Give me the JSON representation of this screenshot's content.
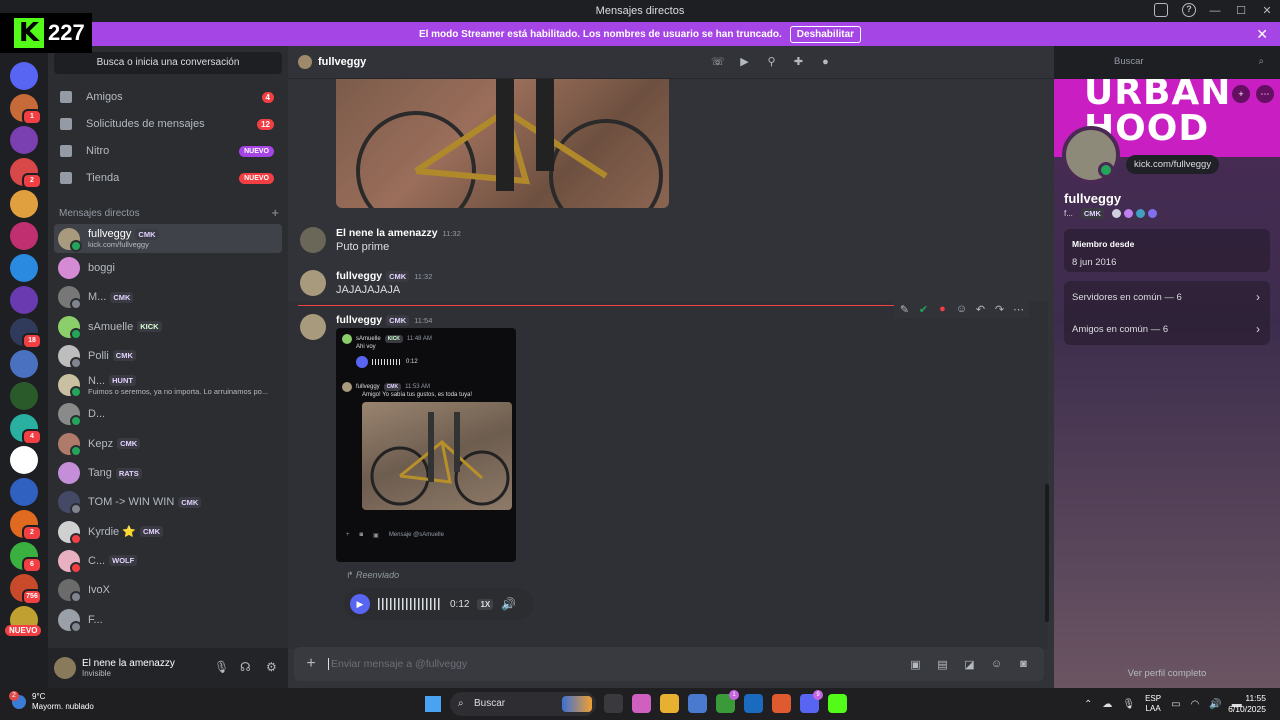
{
  "titlebar": {
    "title": "Mensajes directos"
  },
  "overlay": {
    "kick_count": "227"
  },
  "streamer_bar": {
    "text": "El modo Streamer está habilitado. Los nombres de usuario se han truncado.",
    "button": "Deshabilitar"
  },
  "guilds": {
    "badges": [
      "1",
      "2",
      "18",
      "4",
      "2",
      "6",
      "756"
    ],
    "new_label": "NUEVO"
  },
  "sidebar": {
    "search_placeholder": "Busca o inicia una conversación",
    "nav": [
      {
        "label": "Amigos",
        "count": "4"
      },
      {
        "label": "Solicitudes de mensajes",
        "count": "12"
      },
      {
        "label": "Nitro",
        "pill": "NUEVO"
      },
      {
        "label": "Tienda",
        "pill": "NUEVO"
      }
    ],
    "dm_header": "Mensajes directos",
    "dm_add": "+",
    "dms": [
      {
        "name": "fullveggy",
        "tag": "CMK",
        "sub": "kick.com/fullveggy",
        "color": "#a89a7d",
        "status": "#23a55a"
      },
      {
        "name": "boggi",
        "tag": "",
        "sub": "",
        "color": "#d58ad4",
        "status": ""
      },
      {
        "name": "M...",
        "tag": "CMK",
        "sub": "",
        "color": "#777777",
        "status": "#80848e"
      },
      {
        "name": "sAmuelle",
        "tag": "KICK",
        "sub": "",
        "color": "#8bcf6b",
        "status": "#23a55a"
      },
      {
        "name": "Polli",
        "tag": "CMK",
        "sub": "",
        "color": "#bdbdbd",
        "status": "#80848e"
      },
      {
        "name": "N...",
        "tag": "HUNT",
        "sub": "Fuimos o seremos, ya no importa. Lo arruinamos po...",
        "color": "#c8c0a0",
        "status": "#23a55a"
      },
      {
        "name": "D...",
        "tag": "",
        "sub": "",
        "color": "#8a8a8a",
        "status": "#23a55a"
      },
      {
        "name": "Kepz",
        "tag": "CMK",
        "sub": "",
        "color": "#b07a6a",
        "status": "#23a55a"
      },
      {
        "name": "Tang",
        "tag": "RATS",
        "sub": "",
        "color": "#c48fd8",
        "status": ""
      },
      {
        "name": "TOM -> WIN WIN",
        "tag": "CMK",
        "sub": "",
        "color": "#444a66",
        "status": "#80848e"
      },
      {
        "name": "Kyrdie ⭐",
        "tag": "CMK",
        "sub": "",
        "color": "#d0d0d0",
        "status": "#f23f43"
      },
      {
        "name": "C...",
        "tag": "WOLF",
        "sub": "",
        "color": "#e8b0c0",
        "status": "#f23f43"
      },
      {
        "name": "IvoX",
        "tag": "",
        "sub": "",
        "color": "#6b6b6b",
        "status": "#80848e"
      },
      {
        "name": "F...",
        "tag": "",
        "sub": "",
        "color": "#9aa0a8",
        "status": "#80848e"
      }
    ]
  },
  "user_panel": {
    "name": "El nene la amenazzy",
    "status": "Invisible"
  },
  "chat": {
    "header_name": "fullveggy",
    "search_placeholder": "Buscar",
    "messages": [
      {
        "author": "El nene la amenazzy",
        "time": "11:32",
        "text": "Puto prime",
        "tag": ""
      },
      {
        "author": "fullveggy",
        "time": "11:32",
        "text": "JAJAJAJAJA",
        "tag": "CMK"
      },
      {
        "author": "fullveggy",
        "time": "11:54",
        "text": "",
        "tag": "CMK"
      }
    ],
    "embed": {
      "msg1_author": "sAmuelle",
      "msg1_tag": "KICK",
      "msg1_time": "11:48 AM",
      "msg1_text": "Ahi voy",
      "msg1_dur": "0:12",
      "msg2_author": "fullveggy",
      "msg2_tag": "CMK",
      "msg2_time": "11:53 AM",
      "msg2_text": "Amigo! Yo sabía tus gustos, es toda tuya!",
      "input_placeholder": "Mensaje @sAmuelle"
    },
    "forwarded_label": "Reenviado",
    "voice": {
      "duration": "0:12",
      "speed": "1X"
    },
    "composer_placeholder": "Enviar mensaje a @fullveggy"
  },
  "profile": {
    "banner_text": "URBAN HOOD",
    "url": "kick.com/fullveggy",
    "name": "fullveggy",
    "short": "f...",
    "tag": "CMK",
    "member_since_label": "Miembro desde",
    "member_since": "8 jun 2016",
    "servers_common": "Servidores en común — 6",
    "friends_common": "Amigos en común — 6",
    "view_full": "Ver perfil completo"
  },
  "taskbar": {
    "temp": "9°C",
    "weather": "Mayorm. nublado",
    "weather_badge": "2",
    "search": "Buscar",
    "lang1": "ESP",
    "lang2": "LAA",
    "time": "11:55",
    "date": "6/10/2025"
  }
}
